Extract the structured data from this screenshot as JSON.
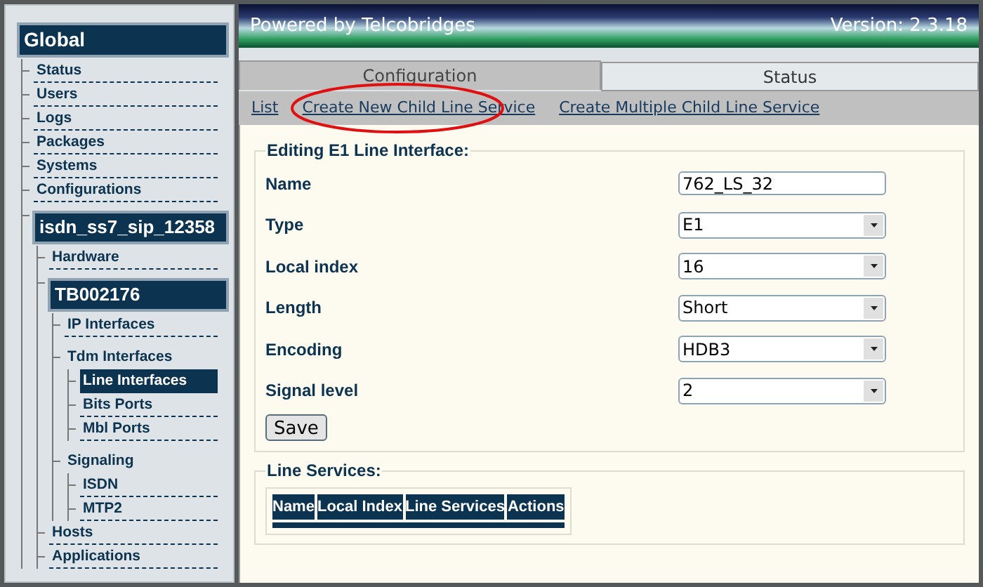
{
  "sidebar": {
    "tree": [
      {
        "label": "Global",
        "kind": "header",
        "children": [
          {
            "label": "Status",
            "kind": "link",
            "selected": false
          },
          {
            "label": "Users",
            "kind": "link",
            "selected": false
          },
          {
            "label": "Logs",
            "kind": "link",
            "selected": false
          },
          {
            "label": "Packages",
            "kind": "link",
            "selected": false
          },
          {
            "label": "Systems",
            "kind": "link",
            "selected": false
          },
          {
            "label": "Configurations",
            "kind": "link",
            "selected": false
          },
          {
            "label": "isdn_ss7_sip_12358",
            "kind": "header",
            "children": [
              {
                "label": "Hardware",
                "kind": "link",
                "selected": false
              },
              {
                "label": "TB002176",
                "kind": "header",
                "children": [
                  {
                    "label": "IP Interfaces",
                    "kind": "link",
                    "selected": false
                  },
                  {
                    "label": "Tdm Interfaces",
                    "kind": "group",
                    "children": [
                      {
                        "label": "Line Interfaces",
                        "kind": "link",
                        "selected": true
                      },
                      {
                        "label": "Bits Ports",
                        "kind": "link",
                        "selected": false
                      },
                      {
                        "label": "Mbl Ports",
                        "kind": "link",
                        "selected": false
                      }
                    ]
                  },
                  {
                    "label": "Signaling",
                    "kind": "group",
                    "children": [
                      {
                        "label": "ISDN",
                        "kind": "link",
                        "selected": false
                      },
                      {
                        "label": "MTP2",
                        "kind": "link",
                        "selected": false
                      }
                    ]
                  }
                ]
              },
              {
                "label": "Hosts",
                "kind": "link",
                "selected": false
              },
              {
                "label": "Applications",
                "kind": "link",
                "selected": false
              }
            ]
          }
        ]
      }
    ]
  },
  "header": {
    "powered_by": "Powered by Telcobridges",
    "version": "Version: 2.3.18"
  },
  "tabs": [
    {
      "label": "Configuration",
      "selected": true
    },
    {
      "label": "Status",
      "selected": false
    }
  ],
  "actions": [
    {
      "label": "List",
      "highlighted": false
    },
    {
      "label": "Create New Child Line Service",
      "highlighted": true
    },
    {
      "label": "Create Multiple Child Line Service",
      "highlighted": false
    }
  ],
  "form": {
    "title": "Editing E1 Line Interface:",
    "fields": [
      {
        "label": "Name",
        "kind": "text",
        "value": "762_LS_32"
      },
      {
        "label": "Type",
        "kind": "select",
        "value": "E1"
      },
      {
        "label": "Local index",
        "kind": "select",
        "value": "16"
      },
      {
        "label": "Length",
        "kind": "select",
        "value": "Short"
      },
      {
        "label": "Encoding",
        "kind": "select",
        "value": "HDB3"
      },
      {
        "label": "Signal level",
        "kind": "select",
        "value": "2"
      }
    ],
    "save_button": "Save"
  },
  "line_services": {
    "title": "Line Services:",
    "columns": [
      "Name",
      "Local Index",
      "Line Services",
      "Actions"
    ]
  }
}
